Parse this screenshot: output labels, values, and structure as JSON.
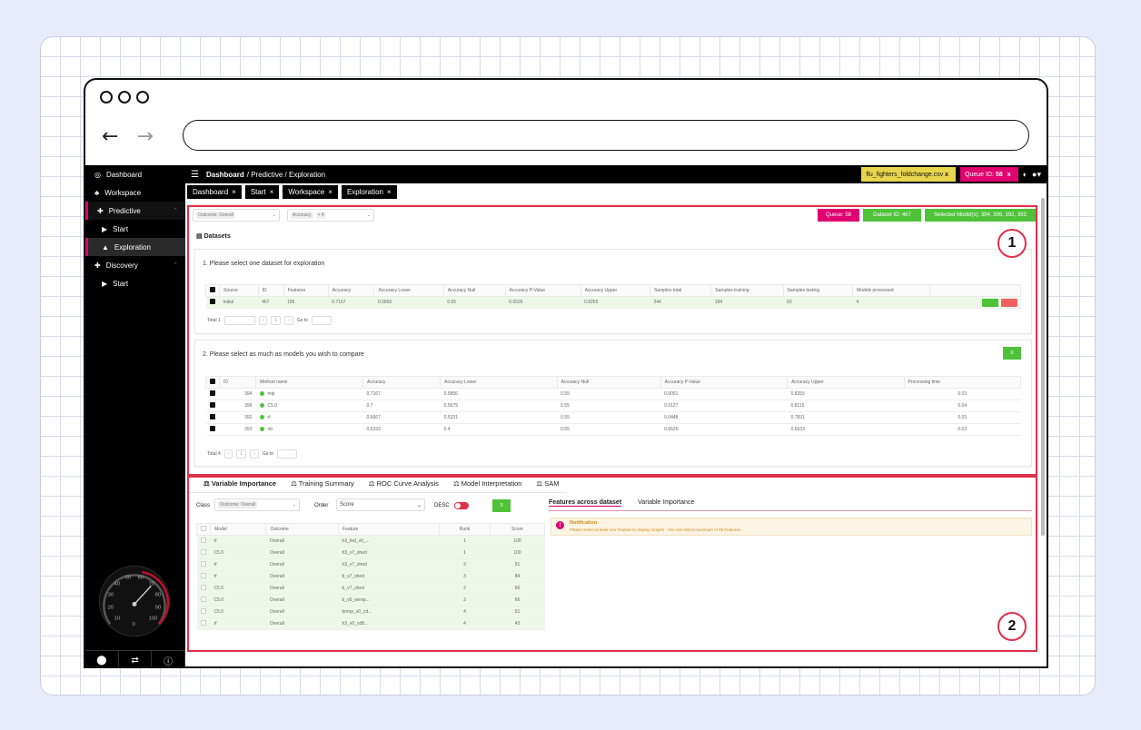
{
  "browser": {
    "back": "←",
    "forward": "→"
  },
  "sidebar": {
    "items": [
      {
        "label": "Dashboard",
        "icon": "dashboard-icon",
        "glyph": "◎"
      },
      {
        "label": "Workspace",
        "icon": "workspace-icon",
        "glyph": "♣"
      },
      {
        "label": "Predictive",
        "icon": "plus-icon",
        "glyph": "✚"
      },
      {
        "label": "Start",
        "icon": "play-icon",
        "glyph": "▶"
      },
      {
        "label": "Exploration",
        "icon": "chart-icon",
        "glyph": "▲"
      },
      {
        "label": "Discovery",
        "icon": "plus-icon",
        "glyph": "✚"
      },
      {
        "label": "Start",
        "icon": "play-icon",
        "glyph": "▶"
      }
    ],
    "gauge_ticks": [
      "10",
      "20",
      "30",
      "40",
      "50",
      "60",
      "70",
      "80",
      "90",
      "100",
      "0"
    ],
    "bottom_icons": [
      "github-icon",
      "translate-icon",
      "info-icon"
    ]
  },
  "topbar": {
    "breadcrumb_root": "Dashboard",
    "breadcrumb_rest": "/ Predictive / Exploration",
    "file_chip": "flu_fighters_foldchange.csv",
    "file_chip_close": "x",
    "queue_label": "Queue ID:",
    "queue_value": "58",
    "queue_close": "x"
  },
  "tabs": [
    "Dashboard",
    "Start",
    "Workspace",
    "Exploration"
  ],
  "tab_close": "×",
  "filters": {
    "outcome_select": "Outcome: Overall",
    "accuracy_select": "Accuracy",
    "accuracy_more": "+ 4"
  },
  "status": {
    "queue": "Queue: 58",
    "dataset": "Dataset ID: 467",
    "models": "Selected Model(s): 394, 396, 392, 393"
  },
  "datasets": {
    "heading": "Datasets",
    "step1": "1. Please select one dataset for exploration",
    "columns": [
      "Source",
      "ID",
      "Features",
      "Accuracy",
      "Accuracy Lower",
      "Accuracy Null",
      "Accuracy P-Value",
      "Accuracy Upper",
      "Samples total",
      "Samples training",
      "Samples testing",
      "Models processed"
    ],
    "rows": [
      [
        "Initial",
        "467",
        "186",
        "0.7167",
        "0.5856",
        "0.55",
        "0.6526",
        "0.8255",
        "244",
        "184",
        "60",
        "4"
      ]
    ],
    "total": "Total 1",
    "page": "1",
    "goto": "Go to"
  },
  "models": {
    "step2": "2. Please select as much as models you wish to compare",
    "columns": [
      "ID",
      "Method name",
      "Accuracy",
      "Accuracy Lower",
      "Accuracy Null",
      "Accuracy P-Value",
      "Accuracy Upper",
      "Processing time"
    ],
    "rows": [
      [
        "394",
        "mlp",
        "0.7167",
        "0.5856",
        "0.55",
        "0.0051",
        "0.8255",
        "0.03"
      ],
      [
        "396",
        "C5.0",
        "0.7",
        "0.5679",
        "0.55",
        "0.0127",
        "0.8115",
        "0.04"
      ],
      [
        "392",
        "rf",
        "0.6667",
        "0.5331",
        "0.55",
        "0.0448",
        "0.7831",
        "0.03"
      ],
      [
        "393",
        "nb",
        "0.5333",
        "0.4",
        "0.55",
        "0.6526",
        "0.6633",
        "0.03"
      ]
    ],
    "total": "Total 4",
    "page": "1",
    "goto": "Go to"
  },
  "analysis": {
    "tabs": [
      "Variable Importance",
      "Training Summary",
      "ROC Curve Analysis",
      "Model Interpretation",
      "SAM"
    ],
    "class_label": "Class",
    "class_value": "Outcome: Overall",
    "order_label": "Order",
    "order_value": "Score",
    "desc_label": "DESC",
    "columns": [
      "Model",
      "Outcome",
      "Feature",
      "Rank",
      "Score"
    ],
    "rows": [
      [
        "rf",
        "Overall",
        "h3_fed_v0_...",
        "1",
        "100"
      ],
      [
        "C5.0",
        "Overall",
        "h3_v7_shed",
        "1",
        "100"
      ],
      [
        "rf",
        "Overall",
        "h3_v7_shed",
        "2",
        "91"
      ],
      [
        "rf",
        "Overall",
        "b_v7_shed",
        "3",
        "84"
      ],
      [
        "C5.0",
        "Overall",
        "b_v7_shed",
        "2",
        "66"
      ],
      [
        "C5.0",
        "Overall",
        "b_v0_serop...",
        "3",
        "66"
      ],
      [
        "C5.0",
        "Overall",
        "bmnp_v0_cd...",
        "4",
        "51"
      ],
      [
        "rf",
        "Overall",
        "h3_v0_cd8...",
        "4",
        "43"
      ]
    ],
    "right_tabs": [
      "Features across dataset",
      "Variable Importance"
    ],
    "notification_title": "Notification",
    "notification_text": "Please select at least one Feature to display Graphs . You can select maximum of 25 Features."
  },
  "markers": [
    "1",
    "2"
  ],
  "colors": {
    "accent_pink": "#e0006f",
    "green": "#4fc23a",
    "yellow": "#e8d44d",
    "highlight_red": "#e0304a"
  }
}
